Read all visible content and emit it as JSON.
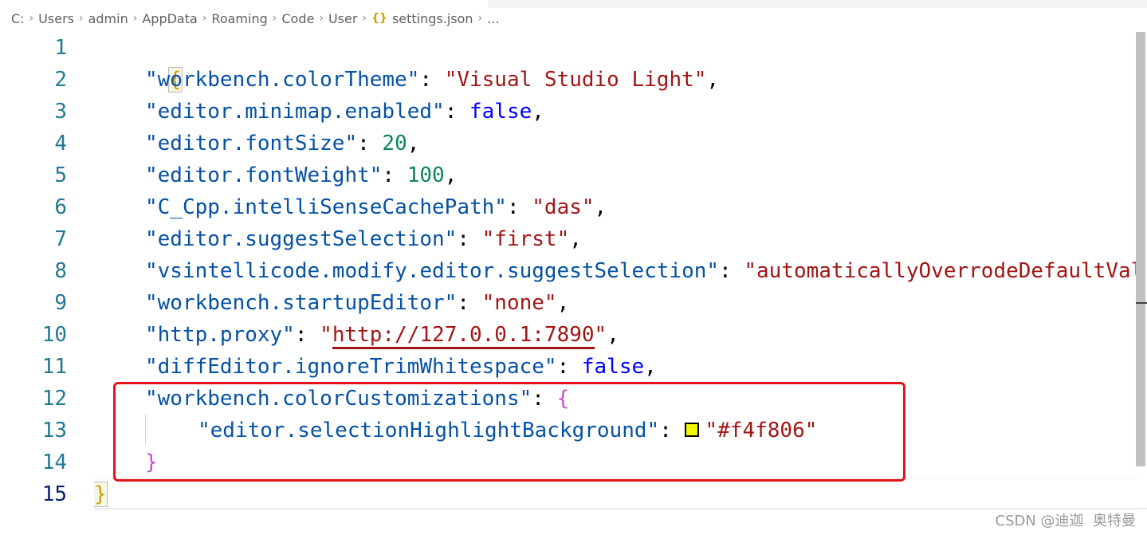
{
  "breadcrumb": {
    "items": [
      "C:",
      "Users",
      "admin",
      "AppData",
      "Roaming",
      "Code",
      "User"
    ],
    "file_icon": "{}",
    "file": "settings.json",
    "ellipsis": "..."
  },
  "colors": {
    "key": "#0451a5",
    "string": "#a31515",
    "keyword": "#0000ff",
    "number": "#098658",
    "annotation": "#e5141b",
    "swatch": "#f4f806"
  },
  "icons": {
    "separator": "chevron-right-icon",
    "file": "json-file-icon",
    "swatch": "color-swatch-icon"
  },
  "editor": {
    "line_numbers": [
      "1",
      "2",
      "3",
      "4",
      "5",
      "6",
      "7",
      "8",
      "9",
      "10",
      "11",
      "12",
      "13",
      "14",
      "15"
    ],
    "active_line": "15",
    "lines": {
      "l1": {
        "open": "{"
      },
      "l2": {
        "key": "\"workbench.colorTheme\"",
        "colon": ": ",
        "value": "\"Visual Studio Light\"",
        "comma": ","
      },
      "l3": {
        "key": "\"editor.minimap.enabled\"",
        "colon": ": ",
        "value": "false",
        "comma": ","
      },
      "l4": {
        "key": "\"editor.fontSize\"",
        "colon": ": ",
        "value": "20",
        "comma": ","
      },
      "l5": {
        "key": "\"editor.fontWeight\"",
        "colon": ": ",
        "value": "100",
        "comma": ","
      },
      "l6": {
        "key": "\"C_Cpp.intelliSenseCachePath\"",
        "colon": ": ",
        "value": "\"das\"",
        "comma": ","
      },
      "l7": {
        "key": "\"editor.suggestSelection\"",
        "colon": ": ",
        "value": "\"first\"",
        "comma": ","
      },
      "l8": {
        "key": "\"vsintellicode.modify.editor.suggestSelection\"",
        "colon": ": ",
        "value": "\"automaticallyOverrodeDefaultValue\"",
        "comma": ","
      },
      "l9": {
        "key": "\"workbench.startupEditor\"",
        "colon": ": ",
        "value": "\"none\"",
        "comma": ","
      },
      "l10": {
        "key": "\"http.proxy\"",
        "colon": ": ",
        "quote_open": "\"",
        "link": "http://127.0.0.1:7890",
        "quote_close": "\"",
        "comma": ","
      },
      "l11": {
        "key": "\"diffEditor.ignoreTrimWhitespace\"",
        "colon": ": ",
        "value": "false",
        "comma": ","
      },
      "l12": {
        "key": "\"workbench.colorCustomizations\"",
        "colon": ": ",
        "open": "{"
      },
      "l13": {
        "key": "\"editor.selectionHighlightBackground\"",
        "colon": ": ",
        "value": "\"#f4f806\""
      },
      "l14": {
        "close": "}"
      },
      "l15": {
        "close": "}"
      }
    }
  },
  "watermark": "CSDN @迪迦 ￼ 奥特曼"
}
